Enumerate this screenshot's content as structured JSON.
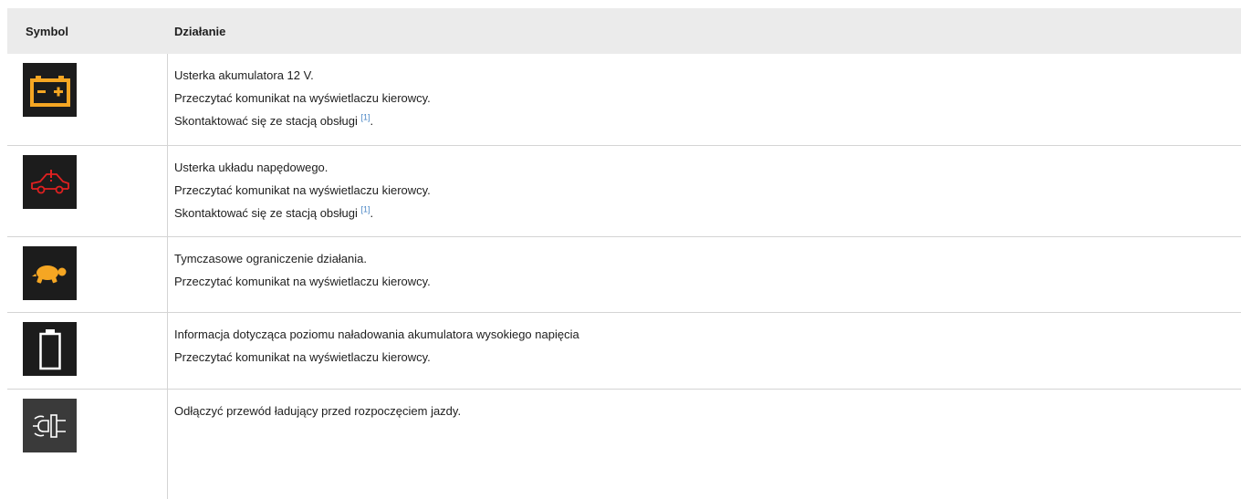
{
  "header": {
    "symbol_label": "Symbol",
    "action_label": "Działanie"
  },
  "rows": [
    {
      "icon": "battery-12v-warning-icon",
      "icon_color": "#f5a623",
      "lines": [
        "Usterka akumulatora 12 V.",
        "Przeczytać komunikat na wyświetlaczu kierowcy.",
        "Skontaktować się ze stacją obsługi "
      ],
      "footnote": "[1]",
      "tail": "."
    },
    {
      "icon": "drivetrain-fault-icon",
      "icon_color": "#e02020",
      "lines": [
        "Usterka układu napędowego.",
        "Przeczytać komunikat na wyświetlaczu kierowcy.",
        "Skontaktować się ze stacją obsługi "
      ],
      "footnote": "[1]",
      "tail": "."
    },
    {
      "icon": "turtle-limited-performance-icon",
      "icon_color": "#f5a623",
      "lines": [
        "Tymczasowe ograniczenie działania.",
        "Przeczytać komunikat na wyświetlaczu kierowcy."
      ]
    },
    {
      "icon": "high-voltage-battery-level-icon",
      "icon_color": "#ffffff",
      "lines": [
        "Informacja dotycząca poziomu naładowania akumulatora wysokiego napięcia",
        "Przeczytać komunikat na wyświetlaczu kierowcy."
      ]
    },
    {
      "icon": "charging-cable-plug-icon",
      "icon_color": "#ffffff",
      "lines": [
        "Odłączyć przewód ładujący przed rozpoczęciem jazdy."
      ]
    }
  ]
}
